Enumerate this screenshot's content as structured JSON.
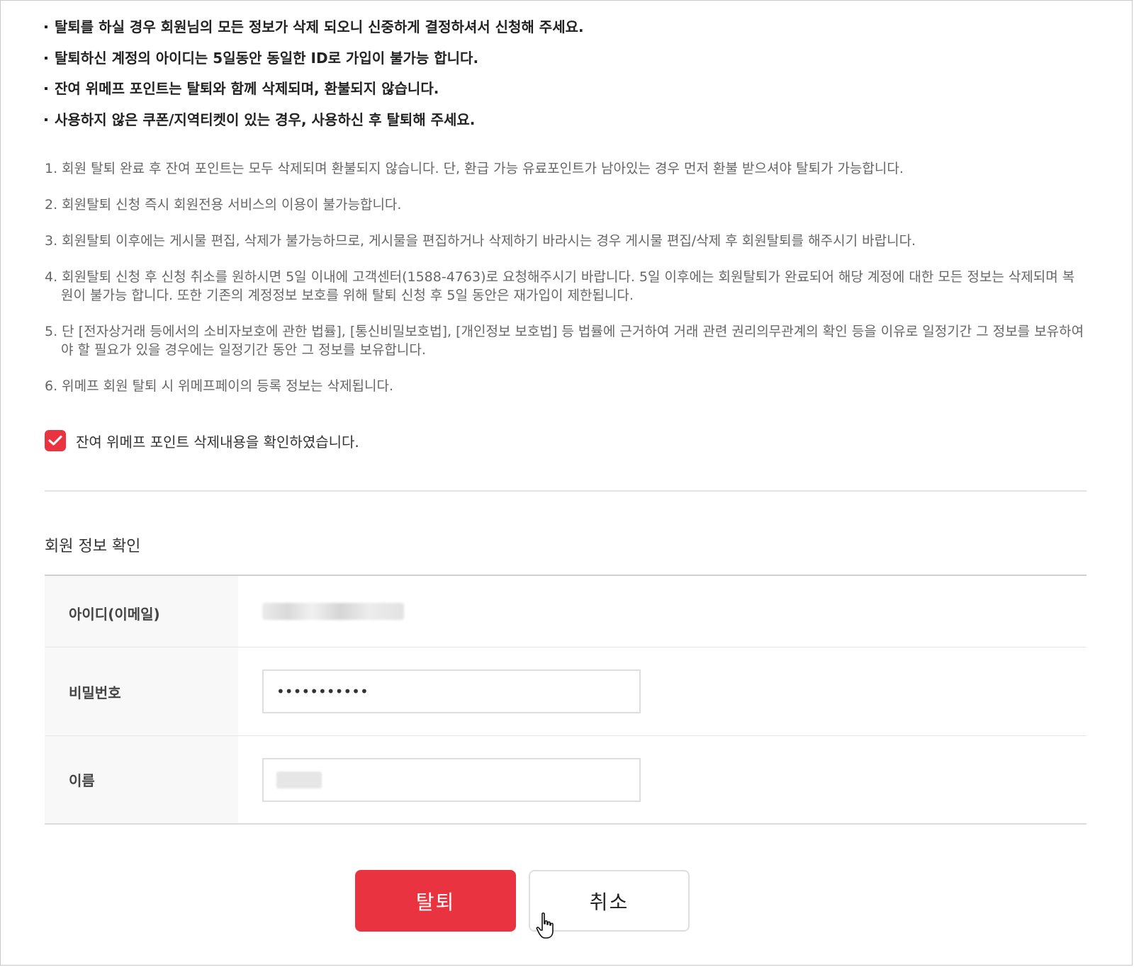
{
  "notices": [
    "탈퇴를 하실 경우 회원님의 모든 정보가 삭제 되오니 신중하게 결정하셔서 신청해 주세요.",
    "탈퇴하신 계정의 아이디는 5일동안 동일한 ID로 가입이 불가능 합니다.",
    "잔여 위메프 포인트는 탈퇴와 함께 삭제되며, 환불되지 않습니다.",
    "사용하지 않은 쿠폰/지역티켓이 있는 경우, 사용하신 후 탈퇴해 주세요."
  ],
  "terms": [
    "1. 회원 탈퇴 완료 후 잔여 포인트는 모두 삭제되며 환불되지 않습니다. 단, 환급 가능 유료포인트가 남아있는 경우 먼저 환불 받으셔야 탈퇴가 가능합니다.",
    "2. 회원탈퇴 신청 즉시 회원전용 서비스의 이용이 불가능합니다.",
    "3. 회원탈퇴 이후에는 게시물 편집, 삭제가 불가능하므로, 게시물을 편집하거나 삭제하기 바라시는 경우 게시물 편집/삭제 후 회원탈퇴를 해주시기 바랍니다.",
    "4. 회원탈퇴 신청 후 신청 취소를 원하시면 5일 이내에 고객센터(1588-4763)로 요청해주시기 바랍니다. 5일 이후에는 회원탈퇴가 완료되어 해당 계정에 대한 모든 정보는 삭제되며 복원이 불가능 합니다. 또한 기존의 계정정보 보호를 위해 탈퇴 신청 후 5일 동안은 재가입이 제한됩니다.",
    "5. 단 [전자상거래 등에서의 소비자보호에 관한 법률], [통신비밀보호법], [개인정보 보호법] 등 법률에 근거하여 거래 관련 권리의무관계의 확인 등을 이유로 일정기간 그 정보를 보유하여야 할 필요가 있을 경우에는 일정기간 동안 그 정보를 보유합니다.",
    "6. 위메프 회원 탈퇴 시 위메프페이의 등록 정보는 삭제됩니다."
  ],
  "agree": {
    "checked": true,
    "label": "잔여 위메프 포인트 삭제내용을 확인하였습니다."
  },
  "member_info": {
    "title": "회원 정보 확인",
    "id_label": "아이디(이메일)",
    "password_label": "비밀번호",
    "password_value": "•••••••••••",
    "name_label": "이름"
  },
  "buttons": {
    "withdraw": "탈퇴",
    "cancel": "취소"
  },
  "colors": {
    "accent": "#ea3340",
    "label_bg": "#f8f8f8",
    "border": "#dedede"
  },
  "icons": {
    "checkbox": "checkmark-icon",
    "cursor": "hand-pointer-icon"
  }
}
